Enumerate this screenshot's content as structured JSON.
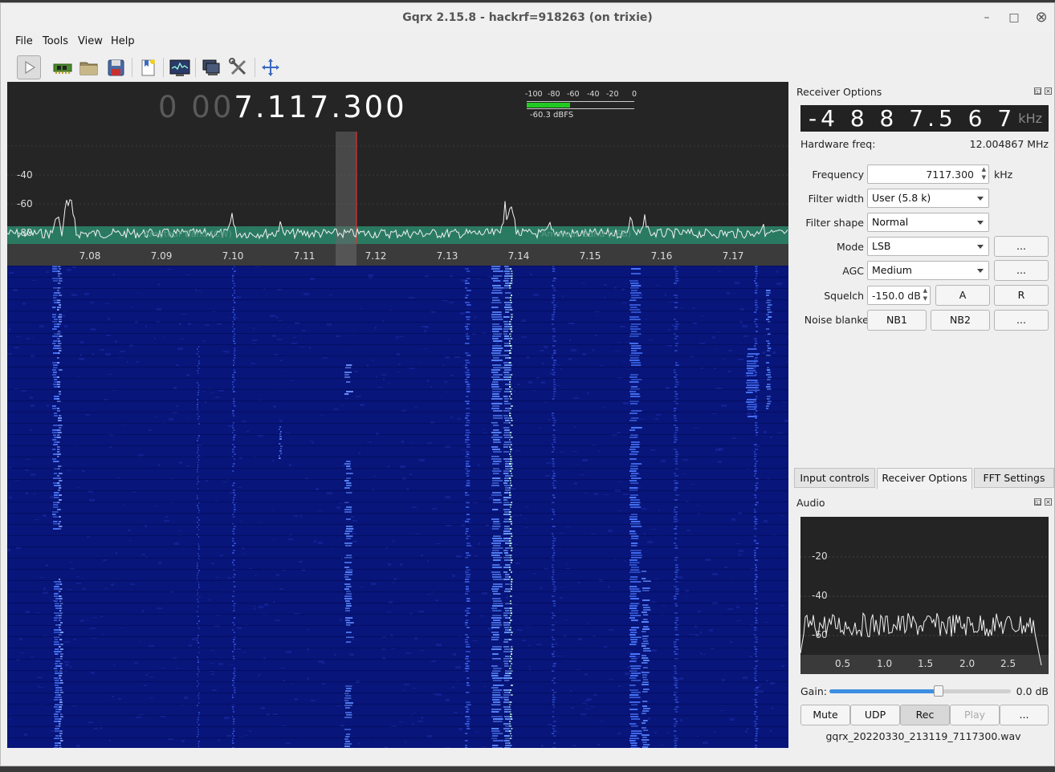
{
  "window": {
    "title": "Gqrx 2.15.8 - hackrf=918263 (on trixie)"
  },
  "menubar": {
    "items": [
      "File",
      "Tools",
      "View",
      "Help"
    ]
  },
  "toolbar": {
    "icons": [
      "play-icon",
      "hardware-icon",
      "open-icon",
      "save-icon",
      "bookmark-icon",
      "fft-icon",
      "remote-icon",
      "settings-icon",
      "fullscreen-icon"
    ]
  },
  "fft_panel": {
    "freq_dim": "0 00",
    "freq_main": "7.117.300",
    "smeter_ticks": [
      "-100",
      "-80",
      "-60",
      "-40",
      "-20",
      "0"
    ],
    "smeter_level": "-60.3 dBFS",
    "smeter_fraction": 0.4,
    "y_labels": [
      "-40",
      "-60",
      "-80"
    ],
    "x_labels": [
      "7.08",
      "7.09",
      "7.10",
      "7.11",
      "7.12",
      "7.13",
      "7.14",
      "7.15",
      "7.16",
      "7.17"
    ],
    "band_labels": [
      "Amateur Band (CW)",
      "Amateur Band (LSB)"
    ]
  },
  "receiver_options": {
    "title": "Receiver Options",
    "offset_display": "-4 8 8 7.5 6 7",
    "offset_unit": "kHz",
    "hw_freq_label": "Hardware freq:",
    "hw_freq_value": "12.004867 MHz",
    "frequency_label": "Frequency",
    "frequency_value": "7117.300",
    "frequency_unit": "kHz",
    "filter_width_label": "Filter width",
    "filter_width_value": "User (5.8 k)",
    "filter_shape_label": "Filter shape",
    "filter_shape_value": "Normal",
    "mode_label": "Mode",
    "mode_value": "LSB",
    "agc_label": "AGC",
    "agc_value": "Medium",
    "squelch_label": "Squelch",
    "squelch_value": "-150.0 dB",
    "squelch_a": "A",
    "squelch_r": "R",
    "noise_blanker_label": "Noise blanker",
    "nb1": "NB1",
    "nb2": "NB2",
    "more": "..."
  },
  "tabs": {
    "items": [
      "Input controls",
      "Receiver Options",
      "FFT Settings"
    ],
    "active": "Receiver Options"
  },
  "audio": {
    "title": "Audio",
    "y_labels": [
      "-20",
      "-40",
      "-60"
    ],
    "x_labels": [
      "0.5",
      "1.0",
      "1.5",
      "2.0",
      "2.5"
    ],
    "gain_label": "Gain:",
    "gain_value": "0.0 dB",
    "gain_fraction": 0.6,
    "mute": "Mute",
    "udp": "UDP",
    "rec": "Rec",
    "play": "Play",
    "more": "...",
    "filename": "gqrx_20220330_213119_7117300.wav"
  }
}
